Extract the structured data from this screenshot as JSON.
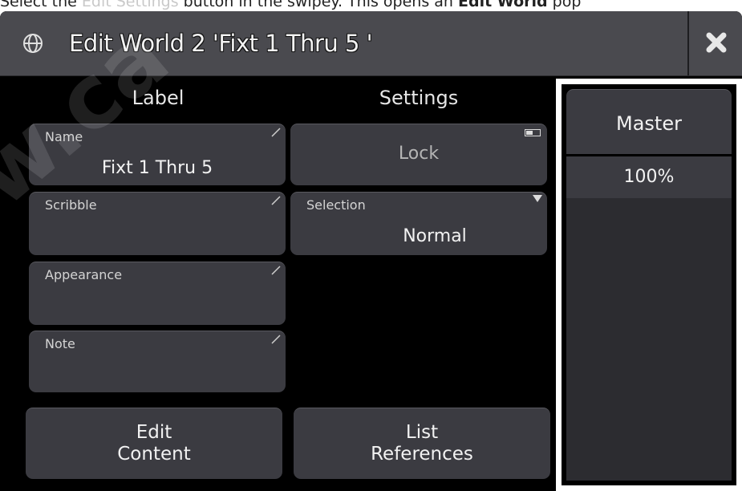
{
  "caption": {
    "pre": "Select the ",
    "highlight": "Edit Settings",
    "mid": " button in the swipey. This opens an ",
    "bold": "Edit World",
    "post": " pop"
  },
  "window": {
    "title": "Edit World 2 'Fixt 1 Thru 5 '",
    "close_icon": "close-icon",
    "globe_icon": "globe-icon"
  },
  "columns": {
    "label_header": "Label",
    "settings_header": "Settings"
  },
  "label_fields": [
    {
      "label": "Name",
      "value": "Fixt 1 Thru 5"
    },
    {
      "label": "Scribble",
      "value": ""
    },
    {
      "label": "Appearance",
      "value": ""
    },
    {
      "label": "Note",
      "value": ""
    }
  ],
  "settings_fields": {
    "lock": {
      "label": "Lock"
    },
    "selection": {
      "label": "Selection",
      "value": "Normal"
    }
  },
  "buttons": {
    "edit_content": [
      "Edit",
      "Content"
    ],
    "list_references": [
      "List",
      "References"
    ]
  },
  "master": {
    "header": "Master",
    "value": "100%",
    "level": 1.0
  },
  "watermark": "w.ca",
  "colors": {
    "window_bg": "#000000",
    "titlebar": "#4a4a4f",
    "button": "#3b3b41",
    "highlight_frame": "#ffffff"
  }
}
